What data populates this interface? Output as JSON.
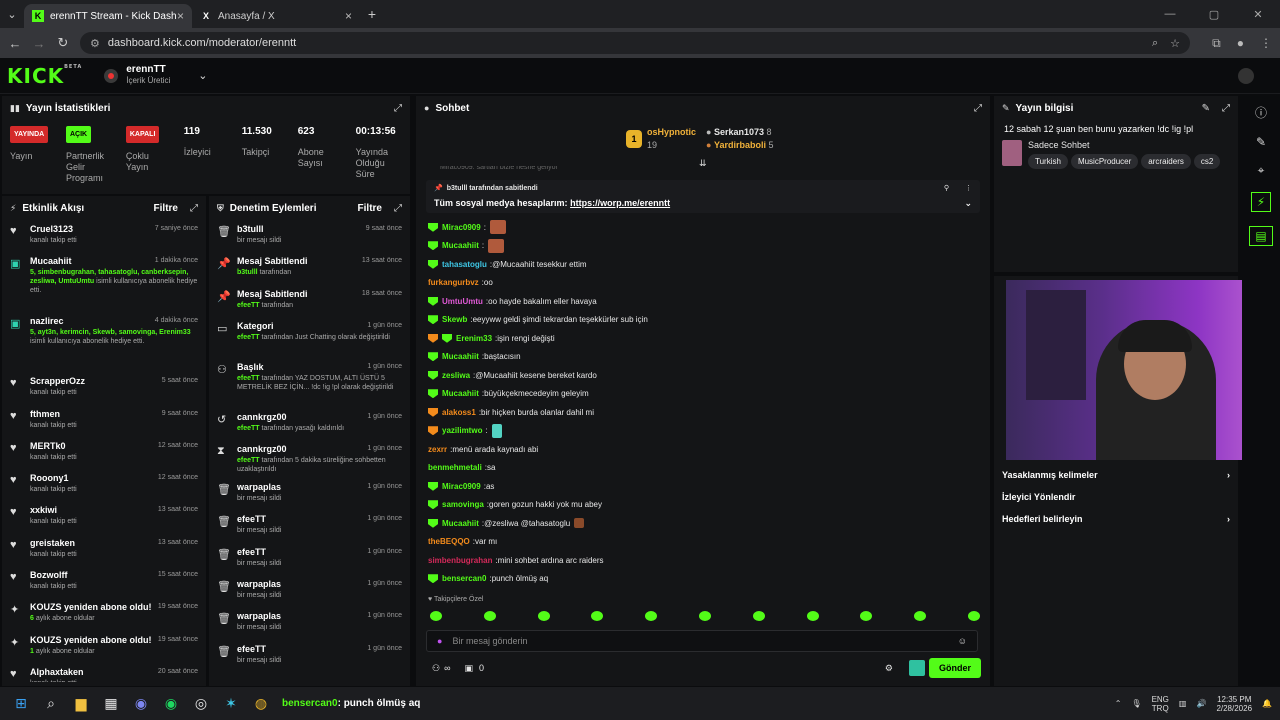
{
  "browser": {
    "tabs": [
      {
        "title": "erennTT Stream - Kick Dashboard",
        "icon": "kick-icon"
      },
      {
        "title": "Anasayfa / X",
        "icon": "x-icon"
      }
    ],
    "url": "dashboard.kick.com/moderator/erenntt"
  },
  "header": {
    "logo": "KICK",
    "logo_sup": "BETA",
    "channel_name": "erennTT",
    "channel_role": "İçerik Üretici"
  },
  "stats_panel": {
    "title": "Yayın İstatistikleri",
    "items": [
      {
        "badge": "YAYINDA",
        "label": "Yayın",
        "color": "#d42a2a"
      },
      {
        "badge": "AÇIK",
        "label": "Partnerlik Gelir Programı",
        "color": "#53fc18"
      },
      {
        "badge": "KAPALI",
        "label": "Çoklu Yayın",
        "color": "#d42a2a"
      },
      {
        "value": "119",
        "label": "İzleyici"
      },
      {
        "value": "11.530",
        "label": "Takipçi"
      },
      {
        "value": "623",
        "label": "Abone Sayısı"
      },
      {
        "value": "00:13:56",
        "label": "Yayında Olduğu Süre"
      }
    ]
  },
  "activity": {
    "title": "Etkinlik Akışı",
    "filter": "Filtre",
    "items": [
      {
        "icon": "heart-icon",
        "name": "Cruel3123",
        "sub": "kanalı takip etti",
        "time": "7 saniye önce"
      },
      {
        "icon": "gift-icon",
        "name": "Mucaahiit",
        "sub_green": "5, simbenbugrahan, tahasatoglu, canberksepin, zesliwa, UmtuUmtu",
        "sub": "isimli kullanıcıya abonelik hediye etti.",
        "time": "1 dakika önce"
      },
      {
        "icon": "gift-icon",
        "name": "nazlirec",
        "sub_green": "5, ayt3n, kerimcin, Skewb, samovinga, Erenim33",
        "sub": "isimli kullanıcıya abonelik hediye etti.",
        "time": "4 dakika önce"
      },
      {
        "icon": "heart-icon",
        "name": "ScrapperOzz",
        "sub": "kanalı takip etti",
        "time": "5 saat önce"
      },
      {
        "icon": "heart-icon",
        "name": "fthmen",
        "sub": "kanalı takip etti",
        "time": "9 saat önce"
      },
      {
        "icon": "heart-icon",
        "name": "MERTk0",
        "sub": "kanalı takip etti",
        "time": "12 saat önce"
      },
      {
        "icon": "heart-icon",
        "name": "Rooony1",
        "sub": "kanalı takip etti",
        "time": "12 saat önce"
      },
      {
        "icon": "heart-icon",
        "name": "xxkiwi",
        "sub": "kanalı takip etti",
        "time": "13 saat önce"
      },
      {
        "icon": "heart-icon",
        "name": "greistaken",
        "sub": "kanalı takip etti",
        "time": "13 saat önce"
      },
      {
        "icon": "heart-icon",
        "name": "Bozwolff",
        "sub": "kanalı takip etti",
        "time": "15 saat önce"
      },
      {
        "icon": "star-icon",
        "name": "KOUZS yeniden abone oldu!",
        "sub_green": "6",
        "sub": "aylık abone oldular",
        "time": "19 saat önce"
      },
      {
        "icon": "star-icon",
        "name": "KOUZS yeniden abone oldu!",
        "sub_green": "1",
        "sub": "aylık abone oldular",
        "time": "19 saat önce"
      },
      {
        "icon": "heart-icon",
        "name": "Alphaxtaken",
        "sub": "kanalı takip etti",
        "time": "20 saat önce"
      }
    ]
  },
  "moderation": {
    "title": "Denetim Eylemleri",
    "filter": "Filtre",
    "items": [
      {
        "icon": "trash-icon",
        "name": "b3tulll",
        "sub": "bir mesajı sildi",
        "time": "9 saat önce"
      },
      {
        "icon": "pin-icon",
        "name": "Mesaj Sabitlendi",
        "sub_green": "b3tulll",
        "sub": "tarafından",
        "time": "13 saat önce"
      },
      {
        "icon": "pin-icon",
        "name": "Mesaj Sabitlendi",
        "sub_green": "efeeTT",
        "sub": "tarafından",
        "time": "18 saat önce"
      },
      {
        "icon": "category-icon",
        "name": "Kategori",
        "sub_green": "efeeTT",
        "sub": "tarafından Just Chatting olarak değiştirildi",
        "time": "1 gün önce"
      },
      {
        "icon": "title-icon",
        "name": "Başlık",
        "sub_green": "efeeTT",
        "sub": "tarafından YAZ DOSTUM, ALTI ÜSTÜ 5 METRELİK BEZ İÇİN... !dc !ig !pl olarak değiştirildi",
        "time": "1 gün önce"
      },
      {
        "icon": "unban-icon",
        "name": "cannkrgz00",
        "sub_green": "efeeTT",
        "sub": "tarafından yasağı kaldırıldı",
        "time": "1 gün önce"
      },
      {
        "icon": "timeout-icon",
        "name": "cannkrgz00",
        "sub_green": "efeeTT",
        "sub": "tarafından 5 dakika süreliğine sohbetten uzaklaştırıldı",
        "time": "1 gün önce"
      },
      {
        "icon": "trash-icon",
        "name": "warpaplas",
        "sub": "bir mesajı sildi",
        "time": "1 gün önce"
      },
      {
        "icon": "trash-icon",
        "name": "efeeTT",
        "sub": "bir mesajı sildi",
        "time": "1 gün önce"
      },
      {
        "icon": "trash-icon",
        "name": "efeeTT",
        "sub": "bir mesajı sildi",
        "time": "1 gün önce"
      },
      {
        "icon": "trash-icon",
        "name": "warpaplas",
        "sub": "bir mesajı sildi",
        "time": "1 gün önce"
      },
      {
        "icon": "trash-icon",
        "name": "warpaplas",
        "sub": "bir mesajı sildi",
        "time": "1 gün önce"
      },
      {
        "icon": "trash-icon",
        "name": "efeeTT",
        "sub": "bir mesajı sildi",
        "time": "1 gün önce"
      }
    ]
  },
  "chat": {
    "title": "Sohbet",
    "leaders": [
      {
        "name": "osHypnotic",
        "count": "19",
        "rank": "1"
      },
      {
        "name": "Serkan1073",
        "count": "8"
      },
      {
        "name": "Yardirbaboli",
        "count": "5"
      }
    ],
    "cut_message": "Mirac0909: sartları bizle nesrie geliyor",
    "pinned_by": "b3tulll tarafından sabitlendi",
    "pinned_text": "Tüm sosyal medya hesaplarım:",
    "pinned_link": "https://worp.me/erenntt",
    "messages": [
      {
        "user": "Mirac0909",
        "color": "#53fc18",
        "badge": "g",
        "text": "",
        "emote": true
      },
      {
        "user": "Mucaahiit",
        "color": "#53fc18",
        "badge": "g",
        "text": "",
        "emote": true
      },
      {
        "user": "tahasatoglu",
        "color": "#3ec7e6",
        "badge": "g",
        "text": "@Mucaahiit tesekkur ettim"
      },
      {
        "user": "furkangurbvz",
        "color": "#f38b1c",
        "badge": "",
        "text": "oo"
      },
      {
        "user": "UmtuUmtu",
        "color": "#e05ad6",
        "badge": "g",
        "text": "oo hayde bakalım eller havaya"
      },
      {
        "user": "Skewb",
        "color": "#53fc18",
        "badge": "g",
        "text": "eeyyww geldi şimdi tekrardan teşekkürler sub için"
      },
      {
        "user": "Erenim33",
        "color": "#53fc18",
        "badge": "og",
        "text": "işin rengi değişti"
      },
      {
        "user": "Mucaahiit",
        "color": "#53fc18",
        "badge": "g",
        "text": "baştacısın"
      },
      {
        "user": "zesliwa",
        "color": "#53fc18",
        "badge": "g",
        "text": "@Mucaahiit kesene bereket kardo"
      },
      {
        "user": "Mucaahiit",
        "color": "#53fc18",
        "badge": "g",
        "text": "büyükçekmecedeyim geleyim"
      },
      {
        "user": "alakoss1",
        "color": "#f38b1c",
        "badge": "o",
        "text": "bir hiçken burda olanlar dahil mi"
      },
      {
        "user": "yazilimtwo",
        "color": "#53fc18",
        "badge": "o",
        "text": "",
        "emote": "g"
      },
      {
        "user": "zexrr",
        "color": "#f38b1c",
        "badge": "",
        "text": "menü arada kaynadı abi"
      },
      {
        "user": "benmehmetali",
        "color": "#53fc18",
        "badge": "",
        "text": "sa"
      },
      {
        "user": "Mirac0909",
        "color": "#53fc18",
        "badge": "g",
        "text": "as"
      },
      {
        "user": "samovinga",
        "color": "#53fc18",
        "badge": "g",
        "text": "goren gozun hakki yok mu abey"
      },
      {
        "user": "Mucaahiit",
        "color": "#53fc18",
        "badge": "g",
        "text": "@zesliwa @tahasatoglu",
        "emote": "s"
      },
      {
        "user": "theBEQQO",
        "color": "#f38b1c",
        "badge": "",
        "text": "var mı"
      },
      {
        "user": "simbenbugrahan",
        "color": "#d42a5a",
        "badge": "",
        "text": "mini sohbet ardına arc raiders"
      },
      {
        "user": "bensercan0",
        "color": "#53fc18",
        "badge": "g",
        "text": "punch ölmüş aq"
      }
    ],
    "followers_only": "Takipçilere Özel",
    "placeholder": "Bir mesaj gönderin",
    "count_a": "∞",
    "count_b": "0",
    "send": "Gönder"
  },
  "stream_info": {
    "title": "Yayın bilgisi",
    "stream_title": "12 sabah 12 şuan ben bunu yazarken !dc !ig !pl",
    "category": "Sadece Sohbet",
    "tags": [
      "Turkish",
      "MusicProducer",
      "arcraiders",
      "cs2"
    ],
    "links": [
      {
        "label": "Yasaklanmış kelimeler",
        "arrow": "›"
      },
      {
        "label": "İzleyici Yönlendir",
        "arrow": ""
      },
      {
        "label": "Hedefleri belirleyin",
        "arrow": "›"
      }
    ]
  },
  "taskbar": {
    "notification_user": "bensercan0",
    "notification_text": ": punch ölmüş aq",
    "lang": "ENG",
    "lang2": "TRQ",
    "time": "12:35 PM",
    "date": "2/28/2026"
  }
}
